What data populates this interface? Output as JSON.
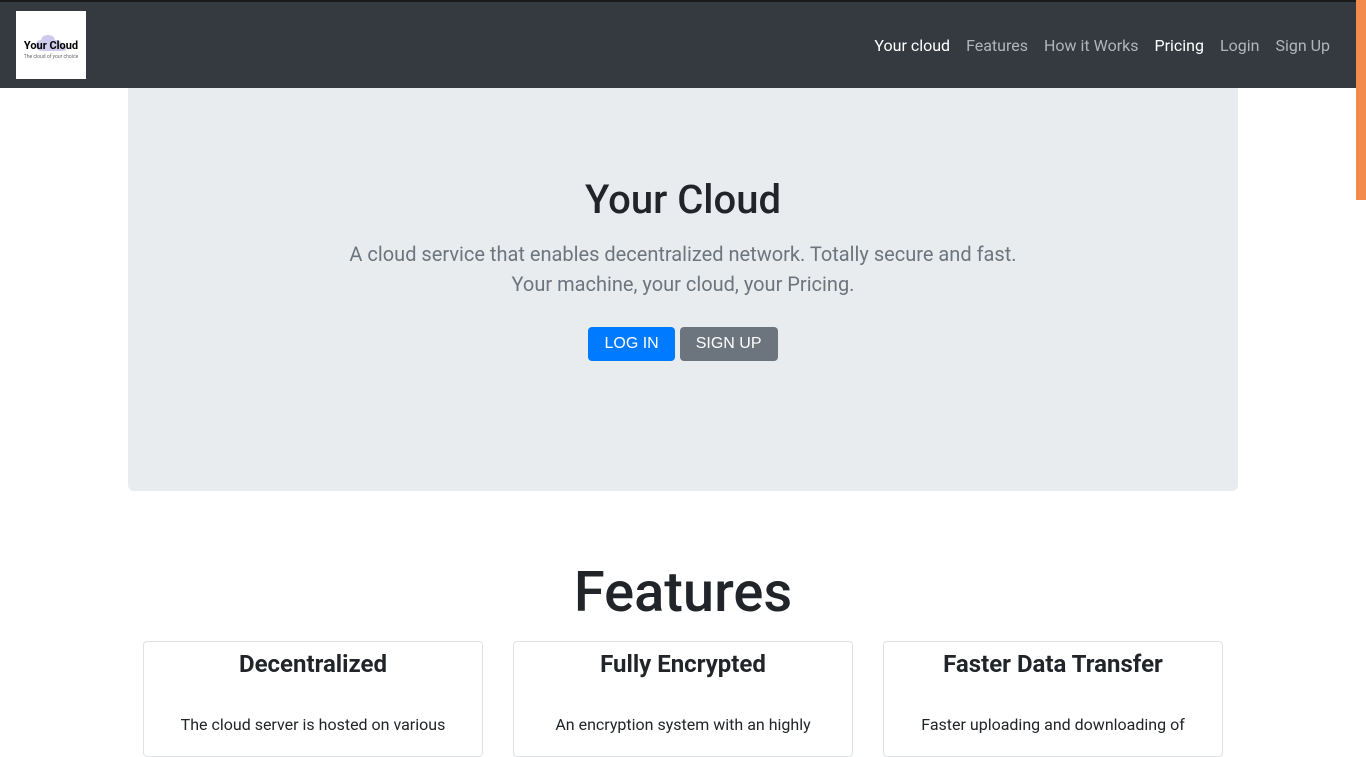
{
  "logo": {
    "text": "Your Cloud",
    "subtext": "The cloud of your choice"
  },
  "nav": {
    "items": [
      {
        "label": "Your cloud",
        "active": true
      },
      {
        "label": "Features",
        "active": false
      },
      {
        "label": "How it Works",
        "active": false
      },
      {
        "label": "Pricing",
        "active": true
      },
      {
        "label": "Login",
        "active": false
      },
      {
        "label": "Sign Up",
        "active": false
      }
    ]
  },
  "hero": {
    "title": "Your Cloud",
    "subtitle_line1": "A cloud service that enables decentralized network. Totally secure and fast.",
    "subtitle_line2": "Your machine, your cloud, your Pricing.",
    "login_label": "LOG IN",
    "signup_label": "SIGN UP"
  },
  "features": {
    "title": "Features",
    "cards": [
      {
        "heading": "Decentralized",
        "desc": "The cloud server is hosted on various"
      },
      {
        "heading": "Fully Encrypted",
        "desc": "An encryption system with an highly"
      },
      {
        "heading": "Faster Data Transfer",
        "desc": "Faster uploading and downloading of"
      }
    ]
  }
}
